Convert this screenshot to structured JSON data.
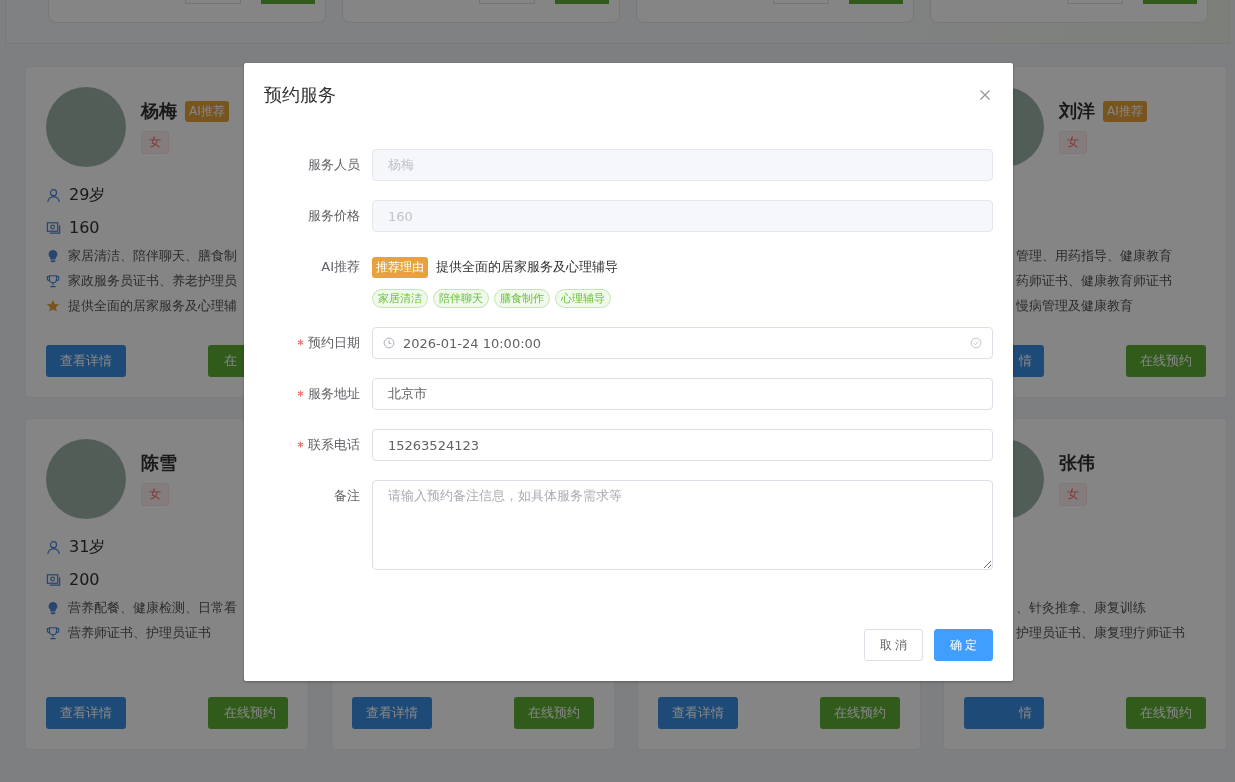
{
  "card_rows": [
    {
      "left": {
        "name": "杨梅",
        "ai_badge": "AI推荐",
        "gender": "女",
        "age": "29岁",
        "price": "160",
        "lines": [
          {
            "kind": "skills",
            "text": "家居清洁、陪伴聊天、膳食制"
          },
          {
            "kind": "certs",
            "text": "家政服务员证书、养老护理员"
          },
          {
            "kind": "intro",
            "text": "提供全面的居家服务及心理辅"
          }
        ],
        "buttons": [
          {
            "kind": "detail",
            "label": "查看详情"
          },
          {
            "kind": "book",
            "label": "在"
          }
        ]
      },
      "right": {
        "name": "刘洋",
        "ai_badge": "AI推荐",
        "gender": "女",
        "lines": [
          "管理、用药指导、健康教育",
          "药师证书、健康教育师证书",
          "慢病管理及健康教育"
        ],
        "buttons": [
          {
            "kind": "detail",
            "label": "情"
          },
          {
            "kind": "book",
            "label": "在线预约"
          }
        ]
      }
    },
    {
      "left": {
        "name": "陈雪",
        "gender": "女",
        "age": "31岁",
        "price": "200",
        "lines": [
          {
            "kind": "skills",
            "text": "营养配餐、健康检测、日常看"
          },
          {
            "kind": "certs",
            "text": "营养师证书、护理员证书"
          }
        ],
        "buttons": [
          {
            "kind": "detail",
            "label": "查看详情"
          },
          {
            "kind": "book",
            "label": "在线预约"
          }
        ]
      },
      "middle": [
        {
          "buttons": [
            {
              "kind": "detail",
              "label": "查看详情"
            },
            {
              "kind": "book",
              "label": "在线预约"
            }
          ]
        },
        {
          "buttons": [
            {
              "kind": "detail",
              "label": "查看详情"
            },
            {
              "kind": "book",
              "label": "在线预约"
            }
          ]
        }
      ],
      "right": {
        "name": "张伟",
        "gender": "女",
        "lines": [
          "、针灸推拿、康复训练",
          "护理员证书、康复理疗师证书"
        ],
        "buttons": [
          {
            "kind": "detail",
            "label": "情"
          },
          {
            "kind": "book",
            "label": "在线预约"
          }
        ]
      }
    }
  ],
  "modal": {
    "title": "预约服务",
    "fields": [
      {
        "kind": "input",
        "label": "服务人员",
        "value": "杨梅",
        "disabled": true,
        "required": false
      },
      {
        "kind": "input",
        "label": "服务价格",
        "value": "160",
        "disabled": true,
        "required": false
      },
      {
        "kind": "ai",
        "label": "AI推荐",
        "badge": "推荐理由",
        "reason": "提供全面的居家服务及心理辅导",
        "tags": [
          "家居清洁",
          "陪伴聊天",
          "膳食制作",
          "心理辅导"
        ]
      },
      {
        "kind": "date",
        "label": "预约日期",
        "value": "2026-01-24 10:00:00",
        "required": true
      },
      {
        "kind": "input",
        "label": "服务地址",
        "value": "北京市",
        "disabled": false,
        "required": true
      },
      {
        "kind": "input",
        "label": "联系电话",
        "value": "15263524123",
        "disabled": false,
        "required": true
      },
      {
        "kind": "textarea",
        "label": "备注",
        "placeholder": "请输入预约备注信息，如具体服务需求等",
        "required": false
      }
    ],
    "buttons": [
      {
        "kind": "default",
        "label": "取 消"
      },
      {
        "kind": "primary",
        "label": "确 定"
      }
    ]
  }
}
